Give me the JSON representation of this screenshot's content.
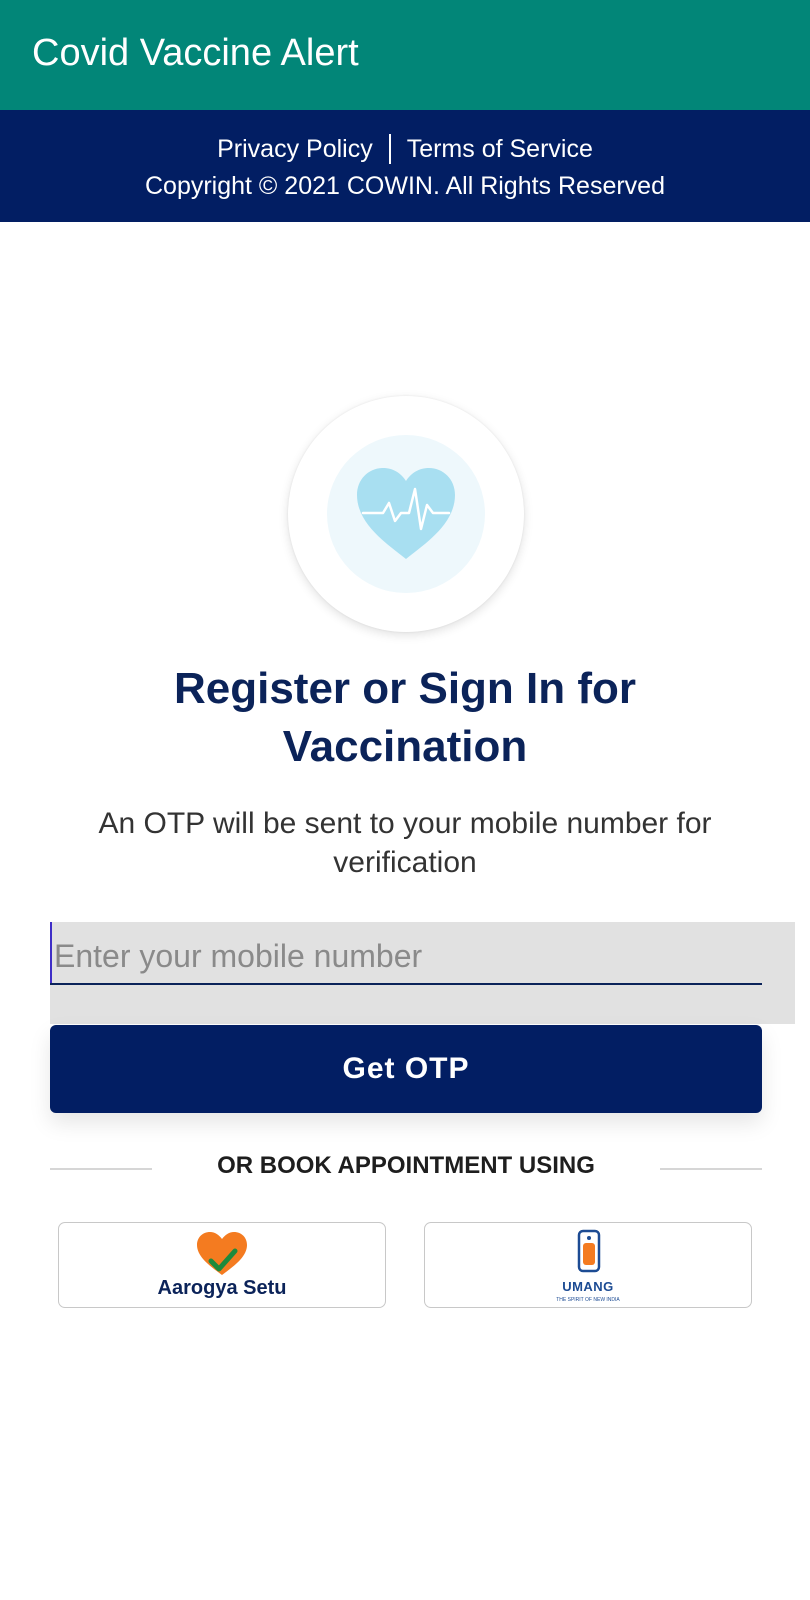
{
  "app_bar": {
    "title": "Covid Vaccine Alert",
    "color": "#028678"
  },
  "footer": {
    "links": [
      "Privacy Policy",
      "Terms of Service"
    ],
    "copyright": "Copyright © 2021 COWIN. All Rights Reserved",
    "color": "#021e63"
  },
  "main": {
    "logo_icon": "heart-pulse-icon",
    "heading": "Register or Sign In for Vaccination",
    "subtext": "An OTP will be sent to your mobile number for verification",
    "mobile_input": {
      "placeholder": "Enter your mobile number",
      "value": ""
    },
    "otp_button": "Get OTP",
    "divider_text": "OR BOOK APPOINTMENT USING",
    "alt_apps": [
      {
        "label": "Aarogya Setu",
        "icon": "aarogya-setu-heart-icon"
      },
      {
        "label": "UMANG",
        "tagline": "THE SPIRIT OF NEW INDIA",
        "icon": "umang-phone-icon"
      }
    ]
  },
  "colors": {
    "accent_teal": "#028678",
    "navy": "#021e63",
    "heading": "#0b2359",
    "heart_blue": "#a8dff1"
  }
}
